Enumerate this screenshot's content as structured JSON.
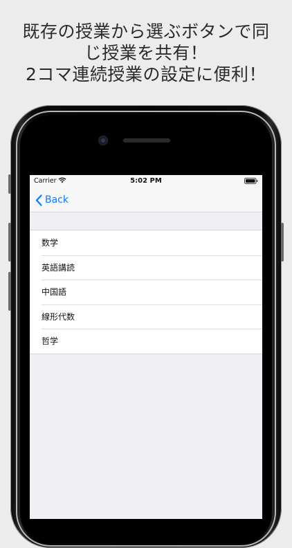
{
  "promo": {
    "line1": "既存の授業から選ぶボタンで同",
    "line2": "じ授業を共有！",
    "line3": "2コマ連続授業の設定に便利！"
  },
  "status_bar": {
    "carrier": "Carrier",
    "time": "5:02 PM",
    "wifi_icon": "wifi-icon",
    "battery_icon": "battery-icon"
  },
  "nav": {
    "back_label": "Back",
    "back_icon": "chevron-left-icon",
    "accent_color": "#0a7aff"
  },
  "subjects": [
    {
      "label": "数学"
    },
    {
      "label": "英語講読"
    },
    {
      "label": "中国語"
    },
    {
      "label": "線形代数"
    },
    {
      "label": "哲学"
    }
  ]
}
